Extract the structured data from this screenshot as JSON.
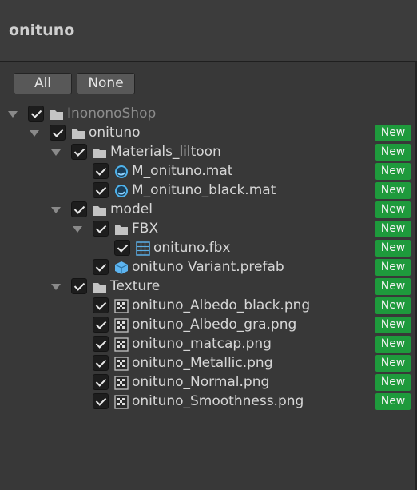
{
  "window": {
    "title": "onituno"
  },
  "buttons": {
    "all": "All",
    "none": "None"
  },
  "badge_text": "New",
  "rows": [
    {
      "label": "InononoShop",
      "icon": "folder-icon",
      "depth": 0,
      "fold": true,
      "badge": false,
      "dim": true
    },
    {
      "label": "onituno",
      "icon": "folder-icon",
      "depth": 1,
      "fold": true,
      "badge": true
    },
    {
      "label": "Materials_liltoon",
      "icon": "folder-icon",
      "depth": 2,
      "fold": true,
      "badge": true
    },
    {
      "label": "M_onituno.mat",
      "icon": "material-icon",
      "depth": 3,
      "fold": false,
      "badge": true
    },
    {
      "label": "M_onituno_black.mat",
      "icon": "material-icon",
      "depth": 3,
      "fold": false,
      "badge": true
    },
    {
      "label": "model",
      "icon": "folder-icon",
      "depth": 2,
      "fold": true,
      "badge": true
    },
    {
      "label": "FBX",
      "icon": "folder-icon",
      "depth": 3,
      "fold": true,
      "badge": true
    },
    {
      "label": "onituno.fbx",
      "icon": "mesh-icon",
      "depth": 4,
      "fold": false,
      "badge": true
    },
    {
      "label": "onituno Variant.prefab",
      "icon": "prefab-icon",
      "depth": 3,
      "fold": false,
      "badge": true
    },
    {
      "label": "Texture",
      "icon": "folder-icon",
      "depth": 2,
      "fold": true,
      "badge": true
    },
    {
      "label": "onituno_Albedo_black.png",
      "icon": "texture-icon",
      "depth": 3,
      "fold": false,
      "badge": true
    },
    {
      "label": "onituno_Albedo_gra.png",
      "icon": "texture-icon",
      "depth": 3,
      "fold": false,
      "badge": true
    },
    {
      "label": "onituno_matcap.png",
      "icon": "texture-icon",
      "depth": 3,
      "fold": false,
      "badge": true
    },
    {
      "label": "onituno_Metallic.png",
      "icon": "texture-icon",
      "depth": 3,
      "fold": false,
      "badge": true
    },
    {
      "label": "onituno_Normal.png",
      "icon": "texture-icon",
      "depth": 3,
      "fold": false,
      "badge": true
    },
    {
      "label": "onituno_Smoothness.png",
      "icon": "texture-icon",
      "depth": 3,
      "fold": false,
      "badge": true
    }
  ],
  "colors": {
    "background": "#383838",
    "badge": "#1e9a3c",
    "folder": "#c4c4c4",
    "material": "#4fb3ec",
    "prefab": "#5db4f0"
  }
}
